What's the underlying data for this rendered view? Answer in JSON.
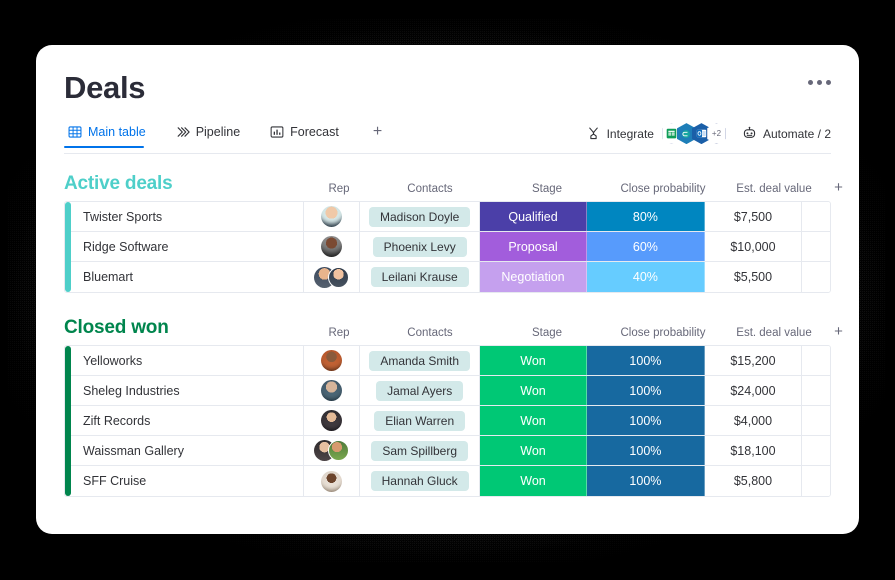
{
  "header": {
    "title": "Deals",
    "menu_icon": "kebab-menu-icon"
  },
  "tabs": [
    {
      "label": "Main table",
      "icon": "table-grid-icon",
      "active": true
    },
    {
      "label": "Pipeline",
      "icon": "chevrons-right-icon",
      "active": false
    },
    {
      "label": "Forecast",
      "icon": "bar-chart-icon",
      "active": false
    }
  ],
  "tab_add_label": "+",
  "toolbar": {
    "integrate_label": "Integrate",
    "integrate_icon": "integrate-icon",
    "app_overflow_label": "+2",
    "automate_label": "Automate / 2",
    "automate_icon": "robot-icon"
  },
  "columns": {
    "name": "",
    "rep": "Rep",
    "contacts": "Contacts",
    "stage": "Stage",
    "probability": "Close probability",
    "value": "Est. deal value",
    "add": "+"
  },
  "groups": [
    {
      "title": "Active deals",
      "color": "#4ecfc9",
      "rows": [
        {
          "name": "Twister Sports",
          "avatars": 1,
          "contact": "Madison Doyle",
          "stage": "Qualified",
          "stage_color": "#4b3fa8",
          "probability": "80%",
          "probability_color": "#0086c0",
          "value": "$7,500"
        },
        {
          "name": "Ridge Software",
          "avatars": 1,
          "contact": "Phoenix Levy",
          "stage": "Proposal",
          "stage_color": "#a25ddc",
          "probability": "60%",
          "probability_color": "#579bfc",
          "value": "$10,000"
        },
        {
          "name": "Bluemart",
          "avatars": 2,
          "contact": "Leilani Krause",
          "stage": "Negotiation",
          "stage_color": "#c5a0ee",
          "probability": "40%",
          "probability_color": "#66ccff",
          "value": "$5,500"
        }
      ]
    },
    {
      "title": "Closed won",
      "color": "#00854d",
      "rows": [
        {
          "name": "Yelloworks",
          "avatars": 1,
          "contact": "Amanda Smith",
          "stage": "Won",
          "stage_color": "#00c875",
          "probability": "100%",
          "probability_color": "#1769a0",
          "value": "$15,200"
        },
        {
          "name": "Sheleg Industries",
          "avatars": 1,
          "contact": "Jamal Ayers",
          "stage": "Won",
          "stage_color": "#00c875",
          "probability": "100%",
          "probability_color": "#1769a0",
          "value": "$24,000"
        },
        {
          "name": "Zift Records",
          "avatars": 1,
          "contact": "Elian Warren",
          "stage": "Won",
          "stage_color": "#00c875",
          "probability": "100%",
          "probability_color": "#1769a0",
          "value": "$4,000"
        },
        {
          "name": "Waissman Gallery",
          "avatars": 2,
          "contact": "Sam Spillberg",
          "stage": "Won",
          "stage_color": "#00c875",
          "probability": "100%",
          "probability_color": "#1769a0",
          "value": "$18,100"
        },
        {
          "name": "SFF Cruise",
          "avatars": 1,
          "contact": "Hannah Gluck",
          "stage": "Won",
          "stage_color": "#00c875",
          "probability": "100%",
          "probability_color": "#1769a0",
          "value": "$5,800"
        }
      ]
    }
  ]
}
